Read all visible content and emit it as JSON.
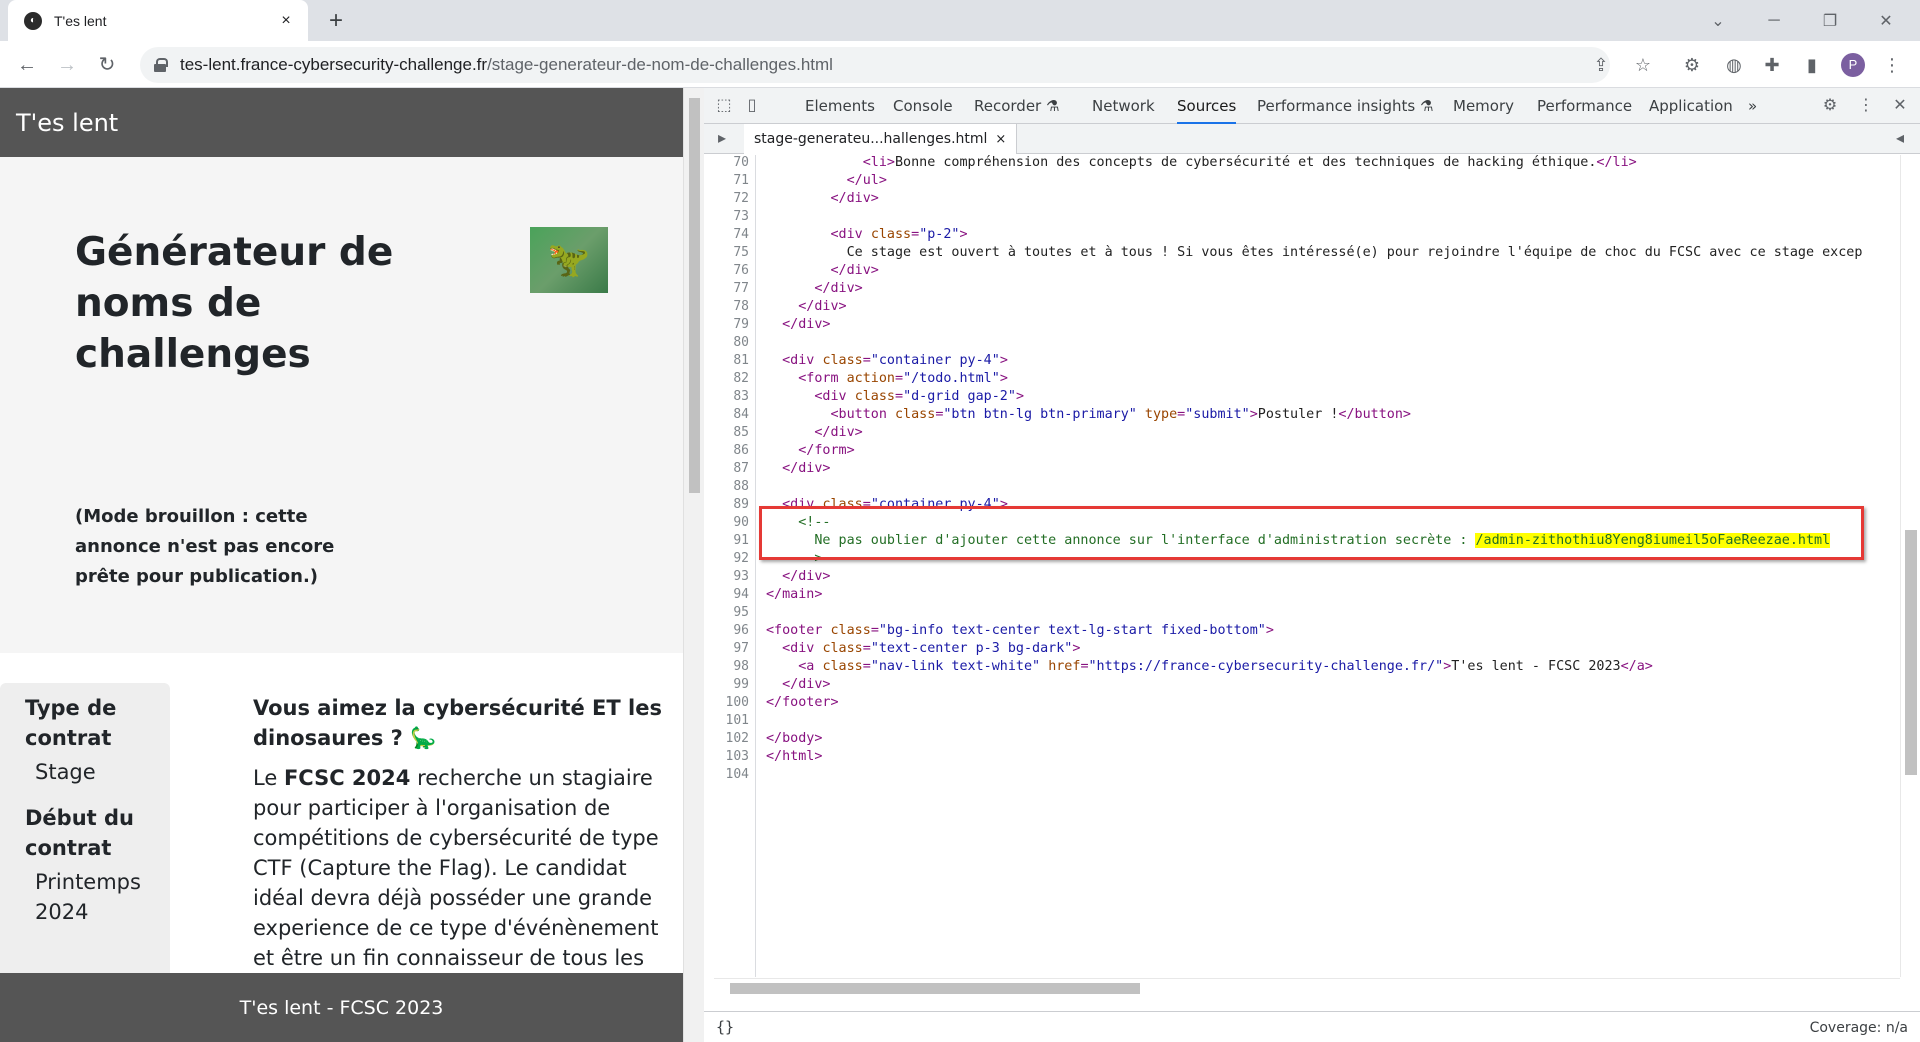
{
  "browser": {
    "tab_title": "T'es lent",
    "tab_close": "×",
    "new_tab": "+",
    "url_host": "tes-lent.france-cybersecurity-challenge.fr",
    "url_path": "/stage-generateur-de-nom-de-challenges.html",
    "profile_initial": "P"
  },
  "page": {
    "brand": "T'es lent",
    "title": "Générateur de noms de challenges",
    "draft_note": "(Mode brouillon : cette annonce n'est pas encore prête pour publication.)",
    "sidebar": [
      {
        "label": "Type de contrat",
        "value": "Stage"
      },
      {
        "label": "Début du contrat",
        "value": "Printemps 2024"
      }
    ],
    "article_heading": "Vous aimez la cybersécurité ET les dinosaures ? 🦕",
    "article_body_pre": "Le ",
    "article_body_bold": "FCSC 2024",
    "article_body_post": " recherche un stagiaire pour participer à l'organisation de compétitions de cybersécurité de type CTF (Capture the Flag). Le candidat idéal devra déjà posséder une grande experience de ce type d'événènement et être un fin connaisseur de tous les",
    "footer": "T'es lent - FCSC 2023"
  },
  "devtools": {
    "tabs": [
      "Elements",
      "Console",
      "Recorder ⚗",
      "Network",
      "Sources",
      "Performance insights ⚗",
      "Memory",
      "Performance",
      "Application"
    ],
    "active_tab": "Sources",
    "more": "»",
    "file_tab": "stage-generateu...hallenges.html",
    "file_close": "×",
    "format_button": "{}",
    "coverage": "Coverage: n/a",
    "line_numbers": [
      "70",
      "71",
      "72",
      "73",
      "74",
      "75",
      "76",
      "77",
      "78",
      "79",
      "80",
      "81",
      "82",
      "83",
      "84",
      "85",
      "86",
      "87",
      "88",
      "89",
      "90",
      "91",
      "92",
      "93",
      "94",
      "95",
      "96",
      "97",
      "98",
      "99",
      "100",
      "101",
      "102",
      "103",
      "104"
    ],
    "code": {
      "l70_indent": "            ",
      "l70_text": "Bonne compréhension des concepts de cybersécurité et des techniques de hacking éthique.",
      "l75_text": "          Ce stage est ouvert à toutes et à tous ! Si vous êtes intéressé(e) pour rejoindre l'équipe de choc du FCSC avec ce stage excep",
      "l91_text": "      Ne pas oublier d'ajouter cette annonce sur l'interface d'administration secrète : ",
      "l91_link": "/admin-zithothiu8Yeng8iumeil5oFaeReezae.html",
      "l84_button": "Postuler !",
      "l98_href": "\"https://france-cybersecurity-challenge.fr/\"",
      "l98_text": "T'es lent - FCSC 2023"
    }
  }
}
